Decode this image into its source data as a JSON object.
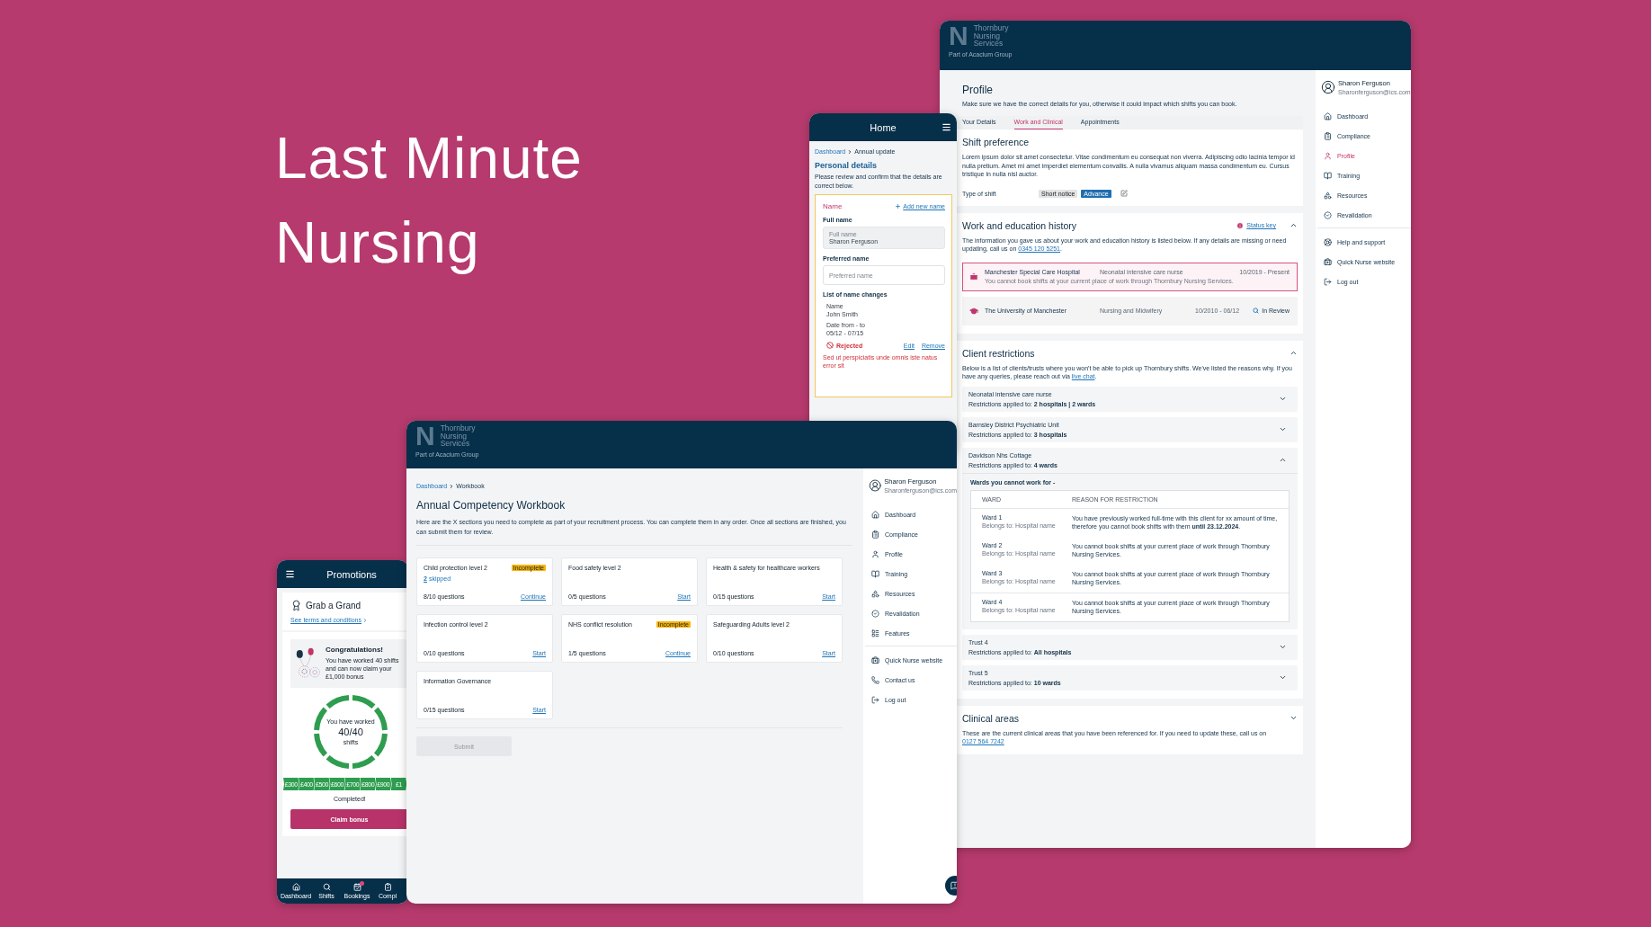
{
  "headline": "Last Minute Nursing",
  "profile": {
    "logo": {
      "mark": "N",
      "lines": [
        "Thornbury",
        "Nursing",
        "Services"
      ],
      "tagline": "Part of Acacium Group"
    },
    "title": "Profile",
    "intro": "Make sure we have the correct details for you, otherwise it could impact which shifts you can book.",
    "tabs": [
      {
        "label": "Your Details",
        "selected": false
      },
      {
        "label": "Work and Clinical",
        "selected": true
      },
      {
        "label": "Appointments",
        "selected": false
      }
    ],
    "shift_preference": {
      "title": "Shift preference",
      "body": "Lorem ipsum dolor sit amet consectetur. Vitae condimentum eu consequat non viverra. Adipiscing odio lacinia tempor id nulla pretium. Amet mi amet imperdiet elementum convallis. A nulla vivamus aliquam massa condimentum eu. Cursus tristique in nulla nisl auctor.",
      "type_label": "Type of shift",
      "options": [
        {
          "label": "Short notice",
          "selected": false
        },
        {
          "label": "Advance",
          "selected": true
        }
      ]
    },
    "history": {
      "title": "Work and education history",
      "status_key": "Status key",
      "expanded": true,
      "intro": "The information you gave us about your work and education history is listed below. If any details are missing or need updating, call us on",
      "phone": "0345 120 5251",
      "intro_end": ".",
      "entries": [
        {
          "kind": "work",
          "name": "Manchester Special Care Hospital",
          "role": "Neonatal intensive care nurse",
          "dates": "10/2019 - Present",
          "note": "You cannot book shifts at your current place of work through Thornbury Nursing Services.",
          "flagged": true
        },
        {
          "kind": "education",
          "name": "The University of Manchester",
          "role": "Nursing and Midwifery",
          "dates": "10/2010 - 06/12",
          "status": "In Review",
          "flagged": false
        }
      ]
    },
    "restrictions": {
      "title": "Client restrictions",
      "expanded": true,
      "intro": "Below is a list of clients/trusts where you won't be able to pick up Thornbury shifts. We've listed the reasons why. If you have any queries, please reach out via",
      "link": "live chat",
      "intro_end": ".",
      "items": [
        {
          "name": "Neonatal intensive care nurse",
          "applied_label": "Restrictions applied to:",
          "applied": "2 hospitals | 2 wards",
          "expanded": false
        },
        {
          "name": "Barnsley District Psychiatric Unit",
          "applied_label": "Restrictions applied to:",
          "applied": "3 hospitals",
          "expanded": false
        },
        {
          "name": "Davidson Nhs Cottage",
          "applied_label": "Restrictions applied to:",
          "applied": "4 wards",
          "expanded": true,
          "wards_title": "Wards you cannot work for -",
          "columns": [
            "WARD",
            "REASON FOR RESTRICTION"
          ],
          "wards": [
            {
              "name": "Ward 1",
              "hospital": "Belongs to: Hospital name",
              "reason": "You have previously worked full-time with this client for xx amount of time, therefore you cannot book shifts with them **until 23.12.2024**."
            },
            {
              "name": "Ward 2",
              "hospital": "Belongs to: Hospital name",
              "reason": "You cannot book shifts at your current place of work through Thornbury Nursing Services."
            },
            {
              "name": "Ward 3",
              "hospital": "Belongs to: Hospital name",
              "reason": "You cannot book shifts at your current place of work through Thornbury Nursing Services."
            },
            {
              "name": "Ward 4",
              "hospital": "Belongs to: Hospital name",
              "reason": "You cannot book shifts at your current place of work through Thornbury Nursing Services."
            }
          ]
        },
        {
          "name": "Trust 4",
          "applied_label": "Restrictions applied to:",
          "applied": "All hospitals",
          "expanded": false
        },
        {
          "name": "Trust 5",
          "applied_label": "Restrictions applied to:",
          "applied": "10 wards",
          "expanded": false
        }
      ]
    },
    "clinical": {
      "title": "Clinical areas",
      "expanded": false,
      "text": "These are the current clinical areas that you have been referenced for. If you need to update these, call us on",
      "phone": "0127 564 7242"
    },
    "user": {
      "name": "Sharon Ferguson",
      "email": "Sharonferguson@ics.com"
    },
    "nav": [
      {
        "label": "Dashboard",
        "selected": false
      },
      {
        "label": "Compliance",
        "selected": false
      },
      {
        "label": "Profile",
        "selected": true
      },
      {
        "label": "Training",
        "selected": false
      },
      {
        "label": "Resources",
        "selected": false
      },
      {
        "label": "Revalidation",
        "selected": false
      }
    ],
    "nav_secondary": [
      {
        "label": "Help and support",
        "selected": false
      },
      {
        "label": "Quick Nurse website",
        "selected": false
      },
      {
        "label": "Log out",
        "selected": false
      }
    ]
  },
  "home": {
    "title": "Home",
    "breadcrumb": [
      "Dashboard",
      "Annual update"
    ],
    "heading": "Personal details",
    "intro": "Please review and confirm that the details are correct below.",
    "card": {
      "title": "Name",
      "add_link": "Add new name",
      "full_name_label": "Full name",
      "full_name_field": {
        "label": "Full name",
        "value": "Sharon Ferguson",
        "disabled": true
      },
      "preferred_label": "Preferred name",
      "preferred_placeholder": "Preferred name",
      "changes_title": "List of name changes",
      "change": {
        "name_label": "Name",
        "name": "John Smith",
        "date_label": "Date from - to",
        "dates": "05/12 - 07/15",
        "status": "Rejected",
        "actions": [
          "Edit",
          "Remove"
        ],
        "note": "Sed ut perspiciatis unde omnis iste natus error sit"
      }
    }
  },
  "workbook": {
    "logo": {
      "mark": "N",
      "lines": [
        "Thornbury",
        "Nursing",
        "Services"
      ],
      "tagline": "Part of Acacium Group"
    },
    "breadcrumb": [
      "Dashboard",
      "Workbook"
    ],
    "title": "Annual Competency Workbook",
    "intro": "Here are the X sections you need to complete as part of your recruitment process. You can complete them in any order. Once all sections are finished, you can submit them for review.",
    "cards": [
      {
        "title": "Child protection level 2",
        "badge": "Incomplete",
        "skipped_count": "2",
        "skipped_label": "skipped",
        "progress": "8/10 questions",
        "action": "Continue"
      },
      {
        "title": "Food safety level 2",
        "progress": "0/5 questions",
        "action": "Start"
      },
      {
        "title": "Health & safety for healthcare workers",
        "progress": "0/15 questions",
        "action": "Start"
      },
      {
        "title": "Infection control level 2",
        "progress": "0/10 questions",
        "action": "Start"
      },
      {
        "title": "NHS conflict resolution",
        "badge": "Incomplete",
        "progress": "1/5 questions",
        "action": "Continue"
      },
      {
        "title": "Safeguarding Adults level 2",
        "progress": "0/10 questions",
        "action": "Start"
      },
      {
        "title": "Information Governance",
        "progress": "0/15 questions",
        "action": "Start"
      }
    ],
    "submit": {
      "label": "Submit",
      "disabled": true
    },
    "user": {
      "name": "Sharon Ferguson",
      "email": "Sharonferguson@ics.com"
    },
    "nav": [
      {
        "label": "Dashboard",
        "selected": false
      },
      {
        "label": "Compliance",
        "selected": false
      },
      {
        "label": "Profile",
        "selected": false
      },
      {
        "label": "Training",
        "selected": false
      },
      {
        "label": "Resources",
        "selected": false
      },
      {
        "label": "Revalidation",
        "selected": false
      },
      {
        "label": "Features",
        "selected": false
      }
    ],
    "nav_secondary": [
      {
        "label": "Quick Nurse website",
        "selected": false
      },
      {
        "label": "Contact us",
        "selected": false
      },
      {
        "label": "Log out",
        "selected": false
      }
    ]
  },
  "promotions": {
    "title": "Promotions",
    "promo_title": "Grab a Grand",
    "terms": "See terms and conditions",
    "congrats_title": "Congratulations!",
    "congrats_text": "You have worked 40 shifts and can now claim your £1,000 bonus",
    "ring": {
      "caption": "You have worked",
      "value": "40/40",
      "unit": "shifts",
      "level": 1
    },
    "steps": [
      {
        "label": "£300",
        "completed": true
      },
      {
        "label": "£400",
        "completed": true
      },
      {
        "label": "£500",
        "completed": true
      },
      {
        "label": "£600",
        "completed": true
      },
      {
        "label": "£700",
        "completed": true
      },
      {
        "label": "£800",
        "completed": true
      },
      {
        "label": "£900",
        "completed": true
      },
      {
        "label": "£1",
        "completed": true
      }
    ],
    "status": "Completed!",
    "button": "Claim bonus",
    "tabs": [
      {
        "label": "Dashboard"
      },
      {
        "label": "Shifts"
      },
      {
        "label": "Bookings",
        "badge": true
      },
      {
        "label": "Compl"
      }
    ]
  }
}
